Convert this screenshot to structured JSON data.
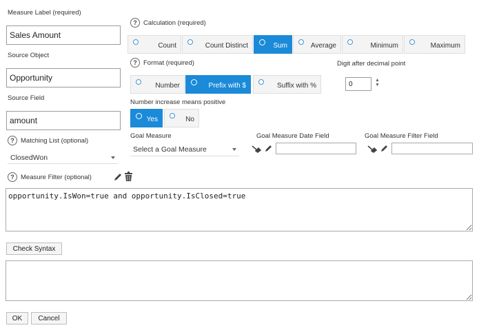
{
  "measure_label": {
    "label": "Measure Label (required)",
    "value": "Sales Amount"
  },
  "source_object": {
    "label": "Source Object",
    "value": "Opportunity"
  },
  "source_field": {
    "label": "Source Field",
    "value": "amount"
  },
  "matching_list": {
    "label": "Matching List (optional)",
    "selected": "ClosedWon"
  },
  "calculation": {
    "label": "Calculation (required)",
    "options": [
      "Count",
      "Count Distinct",
      "Sum",
      "Average",
      "Minimum",
      "Maximum"
    ],
    "selected": "Sum"
  },
  "format": {
    "label": "Format (required)",
    "options": [
      "Number",
      "Prefix with $",
      "Suffix with %"
    ],
    "selected": "Prefix with $"
  },
  "digits": {
    "label": "Digit after decimal point",
    "value": "0"
  },
  "number_increase": {
    "label": "Number increase means positive",
    "options": [
      "Yes",
      "No"
    ],
    "selected": "Yes"
  },
  "goal_measure": {
    "label": "Goal Measure",
    "selected": "Select a Goal Measure"
  },
  "goal_date_field": {
    "label": "Goal Measure Date Field",
    "value": ""
  },
  "goal_filter_field": {
    "label": "Goal Measure Filter Field",
    "value": ""
  },
  "measure_filter": {
    "label": "Measure Filter (optional)",
    "value": "opportunity.IsWon=true and opportunity.IsClosed=true"
  },
  "check_syntax_label": "Check Syntax",
  "syntax_output": "",
  "ok_label": "OK",
  "cancel_label": "Cancel",
  "icons": {
    "help": "question-circle-icon",
    "pencil": "pencil-icon",
    "trash": "trash-icon",
    "broom": "broom-icon",
    "radio": "radio-icon"
  },
  "colors": {
    "accent": "#1b8ad8",
    "radio_ring": "#3c96d8"
  }
}
